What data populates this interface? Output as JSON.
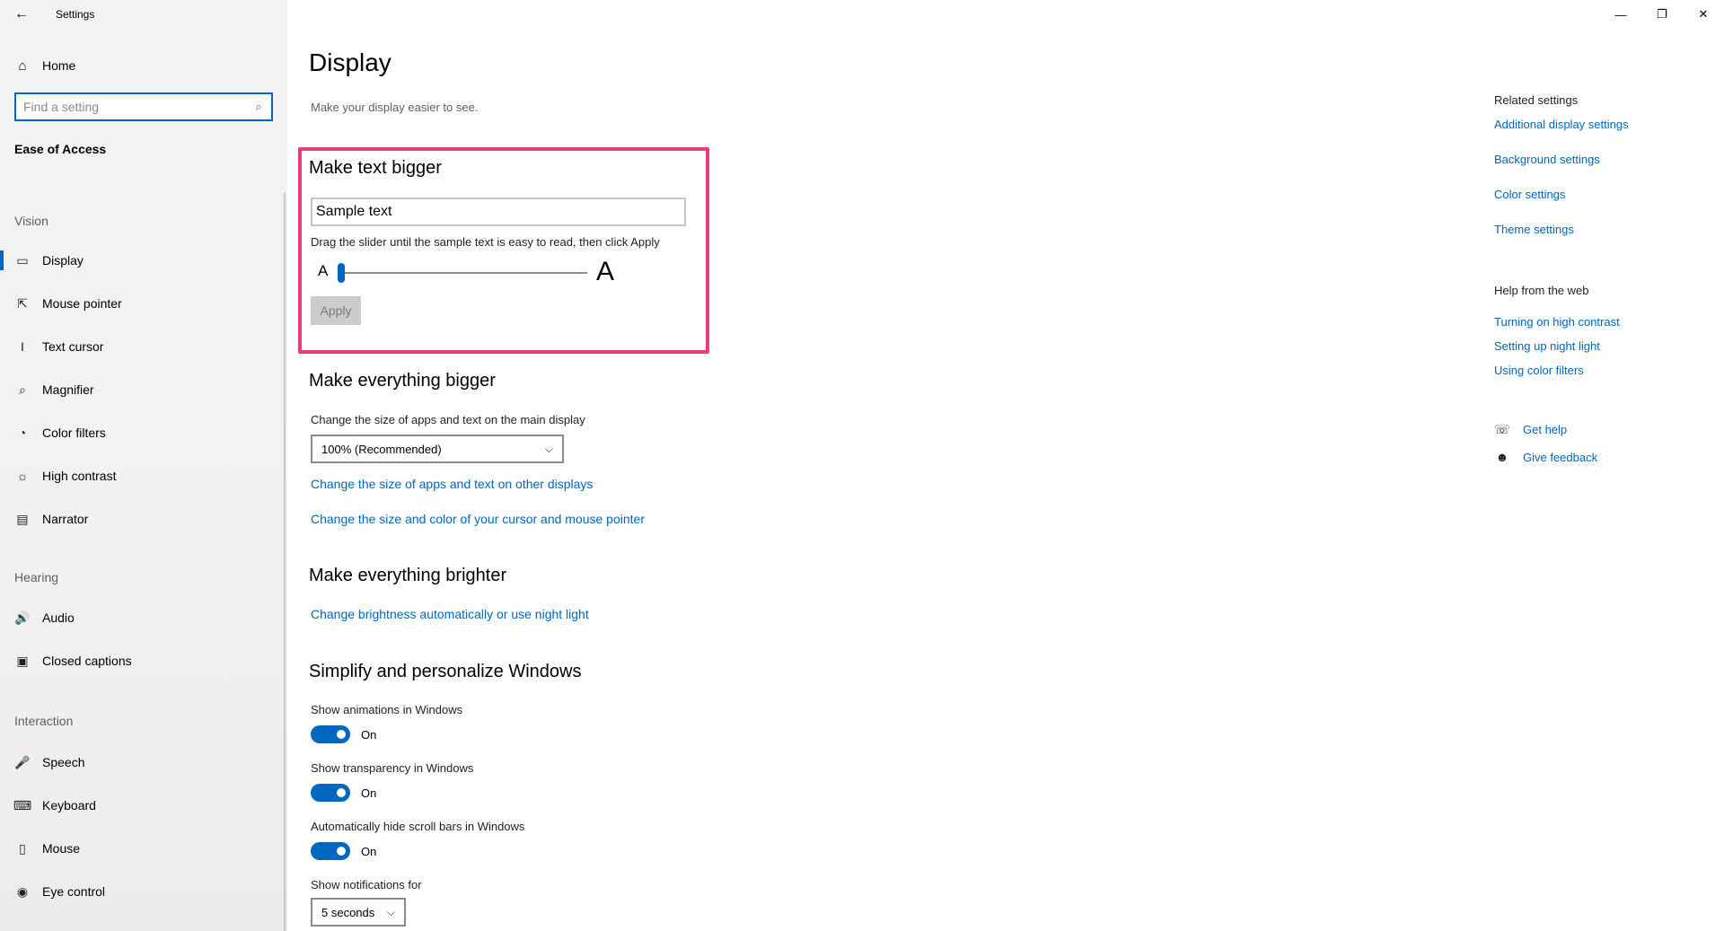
{
  "window": {
    "title": "Settings",
    "back_icon": "←",
    "minimize_icon": "—",
    "restore_icon": "❐",
    "close_icon": "✕"
  },
  "sidebar": {
    "home": {
      "icon": "⌂",
      "label": "Home"
    },
    "search": {
      "placeholder": "Find a setting",
      "icon": "⌕"
    },
    "section": "Ease of Access",
    "groups": [
      {
        "label": "Vision",
        "items": [
          {
            "icon": "▭",
            "label": "Display",
            "active": true
          },
          {
            "icon": "⇱",
            "label": "Mouse pointer"
          },
          {
            "icon": "I",
            "label": "Text cursor"
          },
          {
            "icon": "⌕",
            "label": "Magnifier"
          },
          {
            "icon": "◔",
            "label": "Color filters"
          },
          {
            "icon": "☼",
            "label": "High contrast"
          },
          {
            "icon": "▤",
            "label": "Narrator"
          }
        ]
      },
      {
        "label": "Hearing",
        "items": [
          {
            "icon": "🔊",
            "label": "Audio"
          },
          {
            "icon": "▣",
            "label": "Closed captions"
          }
        ]
      },
      {
        "label": "Interaction",
        "items": [
          {
            "icon": "🎤",
            "label": "Speech"
          },
          {
            "icon": "⌨",
            "label": "Keyboard"
          },
          {
            "icon": "▯",
            "label": "Mouse"
          },
          {
            "icon": "◉",
            "label": "Eye control"
          }
        ]
      }
    ]
  },
  "main": {
    "title": "Display",
    "subtitle": "Make your display easier to see.",
    "text_bigger": {
      "heading": "Make text bigger",
      "sample_text": "Sample text",
      "instruction": "Drag the slider until the sample text is easy to read, then click Apply",
      "small_a": "A",
      "big_a": "A",
      "slider_value_fraction": 0,
      "apply_label": "Apply"
    },
    "everything_bigger": {
      "heading": "Make everything bigger",
      "label": "Change the size of apps and text on the main display",
      "select_value": "100% (Recommended)",
      "link_other_displays": "Change the size of apps and text on other displays",
      "link_cursor": "Change the size and color of your cursor and mouse pointer"
    },
    "brighter": {
      "heading": "Make everything brighter",
      "link": "Change brightness automatically or use night light"
    },
    "simplify": {
      "heading": "Simplify and personalize Windows",
      "animations_label": "Show animations in Windows",
      "animations_state": "On",
      "transparency_label": "Show transparency in Windows",
      "transparency_state": "On",
      "scrollbars_label": "Automatically hide scroll bars in Windows",
      "scrollbars_state": "On",
      "notifications_label": "Show notifications for",
      "notifications_value": "5 seconds"
    },
    "chevron": "⌵"
  },
  "right": {
    "related_heading": "Related settings",
    "related_links": [
      "Additional display settings",
      "Background settings",
      "Color settings",
      "Theme settings"
    ],
    "help_heading": "Help from the web",
    "help_links": [
      "Turning on high contrast",
      "Setting up night light",
      "Using color filters"
    ],
    "get_help": {
      "icon": "☏",
      "label": "Get help"
    },
    "give_feedback": {
      "icon": "☻",
      "label": "Give feedback"
    }
  },
  "colors": {
    "accent": "#0067c0",
    "highlight_border": "#ef3a73"
  }
}
